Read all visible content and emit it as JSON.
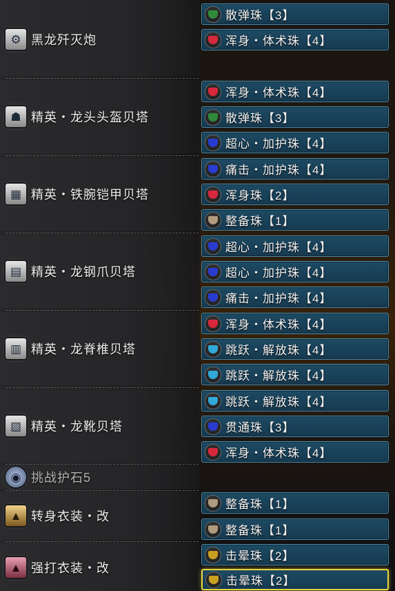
{
  "colors": {
    "red": "#d8283c",
    "green": "#2f8a3a",
    "blue": "#2a3bd0",
    "cyan": "#30a8d8",
    "tan": "#b09a80",
    "gold": "#c8a020"
  },
  "equipment": [
    {
      "name": "黑龙歼灭炮",
      "icon": "bowgun-icon",
      "decorations": [
        {
          "label": "散弹珠【3】",
          "color": "green"
        },
        {
          "label": "浑身・体术珠【4】",
          "color": "red"
        }
      ]
    },
    {
      "name": "精英・龙头头盔贝塔",
      "icon": "helmet-icon",
      "decorations": [
        {
          "label": "浑身・体术珠【4】",
          "color": "red"
        },
        {
          "label": "散弹珠【3】",
          "color": "green"
        },
        {
          "label": "超心・加护珠【4】",
          "color": "blue"
        }
      ]
    },
    {
      "name": "精英・铁腕铠甲贝塔",
      "icon": "chest-armor-icon",
      "decorations": [
        {
          "label": "痛击・加护珠【4】",
          "color": "blue"
        },
        {
          "label": "浑身珠【2】",
          "color": "red"
        },
        {
          "label": "整备珠【1】",
          "color": "tan"
        }
      ]
    },
    {
      "name": "精英・龙钢爪贝塔",
      "icon": "gauntlet-icon",
      "decorations": [
        {
          "label": "超心・加护珠【4】",
          "color": "blue"
        },
        {
          "label": "超心・加护珠【4】",
          "color": "blue"
        },
        {
          "label": "痛击・加护珠【4】",
          "color": "blue"
        }
      ]
    },
    {
      "name": "精英・龙脊椎贝塔",
      "icon": "waist-armor-icon",
      "decorations": [
        {
          "label": "浑身・体术珠【4】",
          "color": "red"
        },
        {
          "label": "跳跃・解放珠【4】",
          "color": "cyan"
        },
        {
          "label": "跳跃・解放珠【4】",
          "color": "cyan"
        }
      ]
    },
    {
      "name": "精英・龙靴贝塔",
      "icon": "greaves-icon",
      "decorations": [
        {
          "label": "跳跃・解放珠【4】",
          "color": "cyan"
        },
        {
          "label": "贯通珠【3】",
          "color": "blue"
        },
        {
          "label": "浑身・体术珠【4】",
          "color": "red"
        }
      ]
    },
    {
      "name": "挑战护石5",
      "icon": "charm-icon",
      "decorations": []
    },
    {
      "name": "转身衣装・改",
      "icon": "mantle-icon",
      "decorations": [
        {
          "label": "整备珠【1】",
          "color": "tan"
        },
        {
          "label": "整备珠【1】",
          "color": "tan"
        }
      ]
    },
    {
      "name": "强打衣装・改",
      "icon": "mantle-icon",
      "decorations": [
        {
          "label": "击晕珠【2】",
          "color": "gold"
        },
        {
          "label": "击晕珠【2】",
          "color": "gold",
          "selected": true
        }
      ]
    }
  ]
}
